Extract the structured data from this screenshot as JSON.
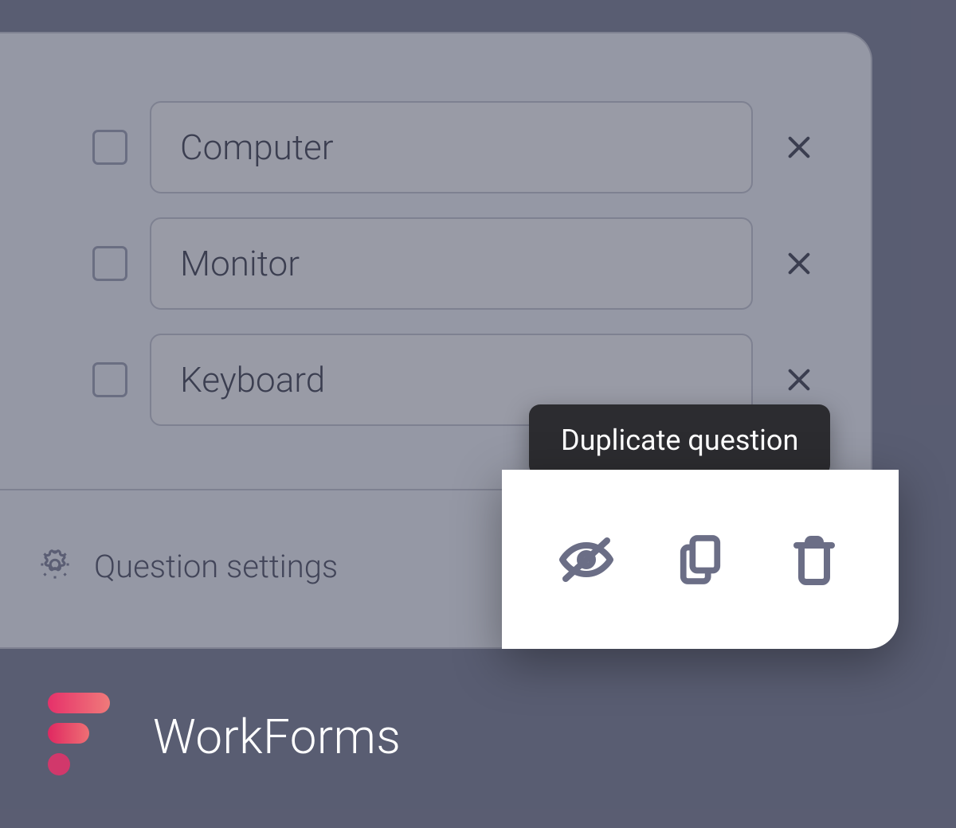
{
  "options": [
    {
      "label": "Computer"
    },
    {
      "label": "Monitor"
    },
    {
      "label": "Keyboard"
    }
  ],
  "settings_label": "Question settings",
  "tooltip": "Duplicate question",
  "brand": "WorkForms",
  "icons": {
    "hide": "eye-off-icon",
    "duplicate": "copy-icon",
    "delete": "trash-icon"
  }
}
